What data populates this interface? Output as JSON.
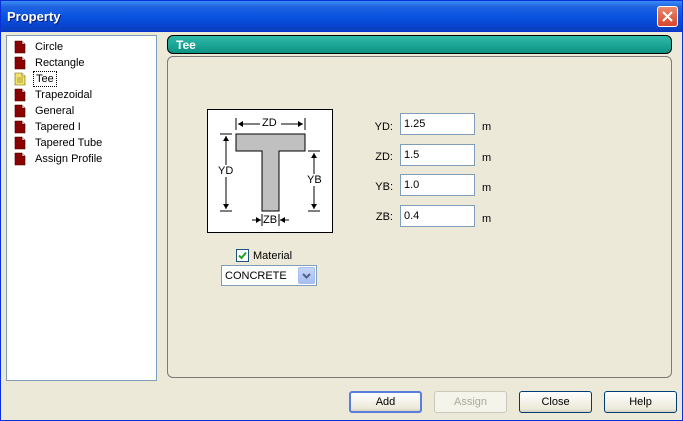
{
  "window": {
    "title": "Property"
  },
  "tree": {
    "items": [
      {
        "label": "Circle",
        "selected": false
      },
      {
        "label": "Rectangle",
        "selected": false
      },
      {
        "label": "Tee",
        "selected": true
      },
      {
        "label": "Trapezoidal",
        "selected": false
      },
      {
        "label": "General",
        "selected": false
      },
      {
        "label": "Tapered I",
        "selected": false
      },
      {
        "label": "Tapered Tube",
        "selected": false
      },
      {
        "label": "Assign Profile",
        "selected": false
      }
    ]
  },
  "panel": {
    "title": "Tee"
  },
  "diagram": {
    "zd": "ZD",
    "yd": "YD",
    "yb": "YB",
    "zb": "ZB"
  },
  "fields": [
    {
      "label": "YD:",
      "value": "1.25",
      "unit": "m"
    },
    {
      "label": "ZD:",
      "value": "1.5",
      "unit": "m"
    },
    {
      "label": "YB:",
      "value": "1.0",
      "unit": "m"
    },
    {
      "label": "ZB:",
      "value": "0.4",
      "unit": "m"
    }
  ],
  "material": {
    "label": "Material",
    "checked": true,
    "selected": "CONCRETE"
  },
  "buttons": {
    "add": "Add",
    "assign": "Assign",
    "close": "Close",
    "help": "Help"
  },
  "colors": {
    "header_teal": "#0d9283",
    "titlebar_blue": "#0a54e3",
    "close_red": "#d6462a"
  }
}
